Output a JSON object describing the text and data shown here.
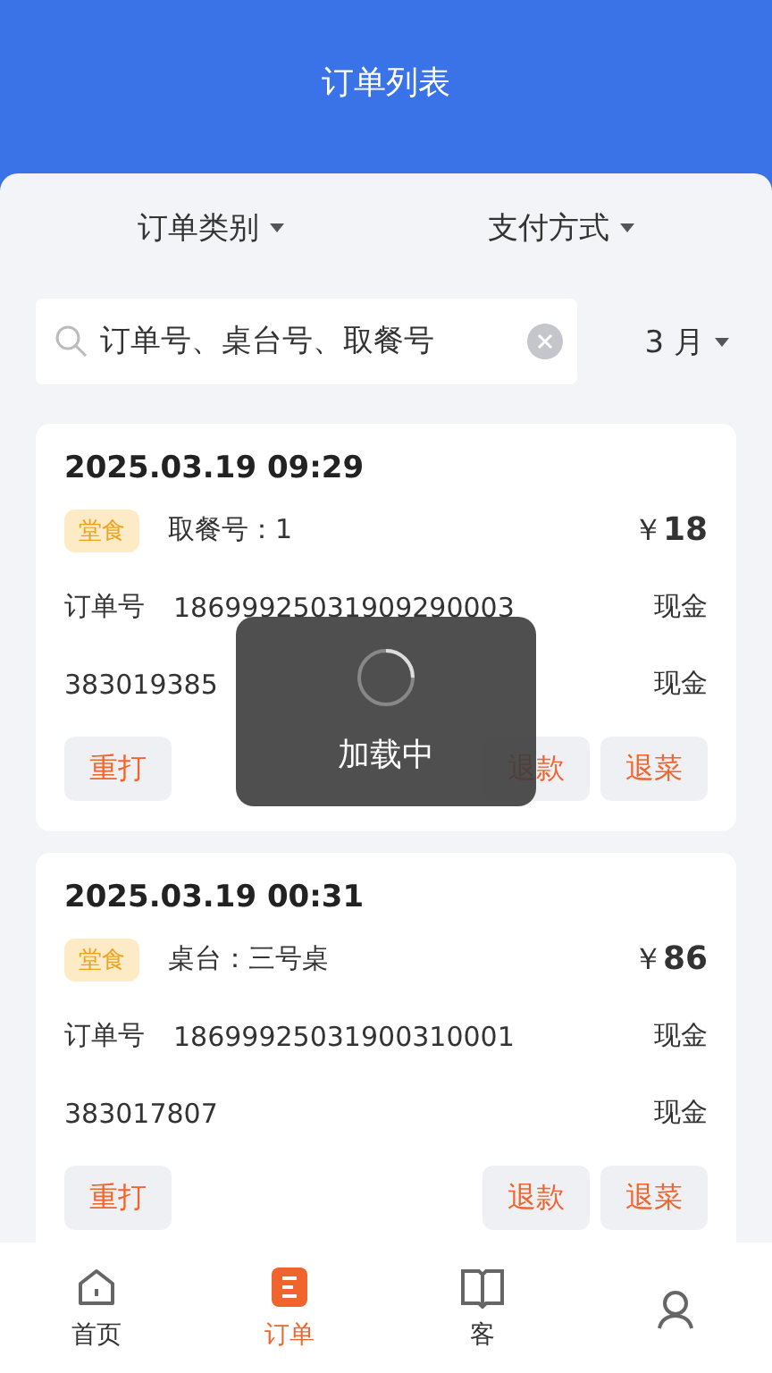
{
  "header": {
    "title": "订单列表"
  },
  "filters": [
    {
      "label": "订单类别"
    },
    {
      "label": "支付方式"
    }
  ],
  "search": {
    "placeholder": "订单号、桌台号、取餐号"
  },
  "month": {
    "label": "3 月"
  },
  "orders": [
    {
      "time": "2025.03.19 09:29",
      "tag": "堂食",
      "info": "取餐号：1",
      "currency": "￥",
      "amount": "18",
      "order_label": "订单号",
      "order_no": "18699925031909290003",
      "pay1": "现金",
      "code": "383019385",
      "pay2": "现金",
      "actions": [
        "重打",
        "退款",
        "退菜"
      ]
    },
    {
      "time": "2025.03.19 00:31",
      "tag": "堂食",
      "info": "桌台：三号桌",
      "currency": "￥",
      "amount": "86",
      "order_label": "订单号",
      "order_no": "18699925031900310001",
      "pay1": "现金",
      "code": "383017807",
      "pay2": "现金",
      "actions": [
        "重打",
        "退款",
        "退菜"
      ]
    }
  ],
  "loading": {
    "text": "加载中"
  },
  "nav": [
    {
      "kind": "home",
      "label": "首页",
      "selected": false
    },
    {
      "kind": "orders",
      "label": "订单",
      "selected": true
    },
    {
      "kind": "book",
      "label": "客",
      "selected": false
    },
    {
      "kind": "profile",
      "selected": false
    }
  ]
}
